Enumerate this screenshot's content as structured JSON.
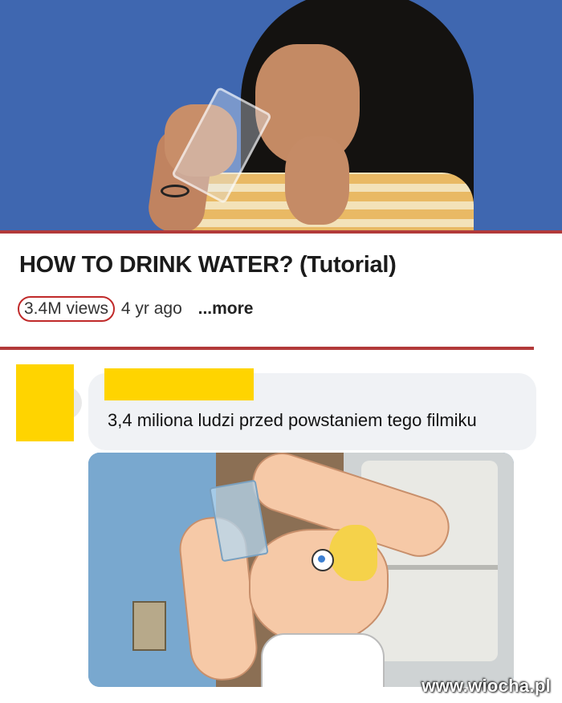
{
  "video": {
    "title": "HOW TO DRINK WATER? (Tutorial)",
    "views": "3.4M views",
    "age": "4 yr ago",
    "more": "...more"
  },
  "comment": {
    "author_redacted": "",
    "text": "3,4 miliona ludzi przed powstaniem tego filmiku",
    "avatar_color": "#ffd400"
  },
  "colors": {
    "accent_line": "#b23a3a",
    "views_circle": "#c02a2a",
    "thumbnail_bg": "#3f67b0",
    "bubble_bg": "#f0f2f5"
  },
  "watermark": "www.wiocha.pl"
}
